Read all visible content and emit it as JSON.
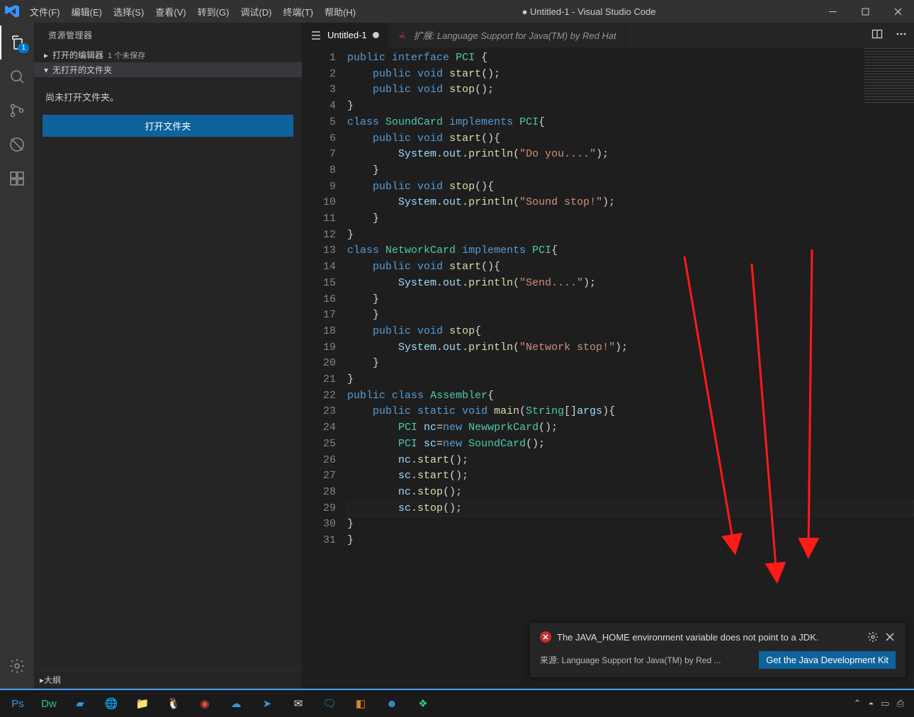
{
  "title": "● Untitled-1 - Visual Studio Code",
  "menu": [
    "文件(F)",
    "编辑(E)",
    "选择(S)",
    "查看(V)",
    "转到(G)",
    "调试(D)",
    "终端(T)",
    "帮助(H)"
  ],
  "activitybar": {
    "badge": "1"
  },
  "sidebar": {
    "title": "资源管理器",
    "open_editors": "打开的编辑器",
    "open_editors_tag": "1 个未保存",
    "no_folder": "无打开的文件夹",
    "hint": "尚未打开文件夹。",
    "open_button": "打开文件夹",
    "outline": "大纲"
  },
  "tabs": {
    "active": "Untitled-1",
    "extension": "扩展: Language Support for Java(TM) by Red Hat"
  },
  "code": {
    "lines": [
      [
        [
          "kw",
          "public"
        ],
        [
          "txt",
          " "
        ],
        [
          "kw",
          "interface"
        ],
        [
          "txt",
          " "
        ],
        [
          "typ",
          "PCI"
        ],
        [
          "txt",
          " {"
        ]
      ],
      [
        [
          "txt",
          "    "
        ],
        [
          "kw",
          "public"
        ],
        [
          "txt",
          " "
        ],
        [
          "kw",
          "void"
        ],
        [
          "txt",
          " "
        ],
        [
          "fn",
          "start"
        ],
        [
          "txt",
          "();"
        ]
      ],
      [
        [
          "txt",
          "    "
        ],
        [
          "kw",
          "public"
        ],
        [
          "txt",
          " "
        ],
        [
          "kw",
          "void"
        ],
        [
          "txt",
          " "
        ],
        [
          "fn",
          "stop"
        ],
        [
          "txt",
          "();"
        ]
      ],
      [
        [
          "txt",
          "}"
        ]
      ],
      [
        [
          "kw",
          "class"
        ],
        [
          "txt",
          " "
        ],
        [
          "typ",
          "SoundCard"
        ],
        [
          "txt",
          " "
        ],
        [
          "kw",
          "implements"
        ],
        [
          "txt",
          " "
        ],
        [
          "typ",
          "PCI"
        ],
        [
          "txt",
          "{"
        ]
      ],
      [
        [
          "txt",
          "    "
        ],
        [
          "kw",
          "public"
        ],
        [
          "txt",
          " "
        ],
        [
          "kw",
          "void"
        ],
        [
          "txt",
          " "
        ],
        [
          "fn",
          "start"
        ],
        [
          "txt",
          "(){"
        ]
      ],
      [
        [
          "txt",
          "        "
        ],
        [
          "id",
          "System"
        ],
        [
          "txt",
          "."
        ],
        [
          "id",
          "out"
        ],
        [
          "txt",
          "."
        ],
        [
          "fn",
          "println"
        ],
        [
          "txt",
          "("
        ],
        [
          "str",
          "\"Do you....\""
        ],
        [
          "txt",
          ");"
        ]
      ],
      [
        [
          "txt",
          "    }"
        ]
      ],
      [
        [
          "txt",
          "    "
        ],
        [
          "kw",
          "public"
        ],
        [
          "txt",
          " "
        ],
        [
          "kw",
          "void"
        ],
        [
          "txt",
          " "
        ],
        [
          "fn",
          "stop"
        ],
        [
          "txt",
          "(){"
        ]
      ],
      [
        [
          "txt",
          "        "
        ],
        [
          "id",
          "System"
        ],
        [
          "txt",
          "."
        ],
        [
          "id",
          "out"
        ],
        [
          "txt",
          "."
        ],
        [
          "fn",
          "println"
        ],
        [
          "txt",
          "("
        ],
        [
          "str",
          "\"Sound stop!\""
        ],
        [
          "txt",
          ");"
        ]
      ],
      [
        [
          "txt",
          "    }"
        ]
      ],
      [
        [
          "txt",
          "}"
        ]
      ],
      [
        [
          "kw",
          "class"
        ],
        [
          "txt",
          " "
        ],
        [
          "typ",
          "NetworkCard"
        ],
        [
          "txt",
          " "
        ],
        [
          "kw",
          "implements"
        ],
        [
          "txt",
          " "
        ],
        [
          "typ",
          "PCI"
        ],
        [
          "txt",
          "{"
        ]
      ],
      [
        [
          "txt",
          "    "
        ],
        [
          "kw",
          "public"
        ],
        [
          "txt",
          " "
        ],
        [
          "kw",
          "void"
        ],
        [
          "txt",
          " "
        ],
        [
          "fn",
          "start"
        ],
        [
          "txt",
          "(){"
        ]
      ],
      [
        [
          "txt",
          "        "
        ],
        [
          "id",
          "System"
        ],
        [
          "txt",
          "."
        ],
        [
          "id",
          "out"
        ],
        [
          "txt",
          "."
        ],
        [
          "fn",
          "println"
        ],
        [
          "txt",
          "("
        ],
        [
          "str",
          "\"Send....\""
        ],
        [
          "txt",
          ");"
        ]
      ],
      [
        [
          "txt",
          "    }"
        ]
      ],
      [
        [
          "txt",
          "    }"
        ]
      ],
      [
        [
          "txt",
          "    "
        ],
        [
          "kw",
          "public"
        ],
        [
          "txt",
          " "
        ],
        [
          "kw",
          "void"
        ],
        [
          "txt",
          " "
        ],
        [
          "fn",
          "stop"
        ],
        [
          "txt",
          "{"
        ]
      ],
      [
        [
          "txt",
          "        "
        ],
        [
          "id",
          "System"
        ],
        [
          "txt",
          "."
        ],
        [
          "id",
          "out"
        ],
        [
          "txt",
          "."
        ],
        [
          "fn",
          "println"
        ],
        [
          "txt",
          "("
        ],
        [
          "str",
          "\"Network stop!\""
        ],
        [
          "txt",
          ");"
        ]
      ],
      [
        [
          "txt",
          "    }"
        ]
      ],
      [
        [
          "txt",
          "}"
        ]
      ],
      [
        [
          "kw",
          "public"
        ],
        [
          "txt",
          " "
        ],
        [
          "kw",
          "class"
        ],
        [
          "txt",
          " "
        ],
        [
          "typ",
          "Assembler"
        ],
        [
          "txt",
          "{"
        ]
      ],
      [
        [
          "txt",
          "    "
        ],
        [
          "kw",
          "public"
        ],
        [
          "txt",
          " "
        ],
        [
          "kw",
          "static"
        ],
        [
          "txt",
          " "
        ],
        [
          "kw",
          "void"
        ],
        [
          "txt",
          " "
        ],
        [
          "fn",
          "main"
        ],
        [
          "txt",
          "("
        ],
        [
          "typ",
          "String"
        ],
        [
          "txt",
          "[]"
        ],
        [
          "id",
          "args"
        ],
        [
          "txt",
          "){"
        ]
      ],
      [
        [
          "txt",
          "        "
        ],
        [
          "typ",
          "PCI"
        ],
        [
          "txt",
          " "
        ],
        [
          "id",
          "nc"
        ],
        [
          "txt",
          "="
        ],
        [
          "kw",
          "new"
        ],
        [
          "txt",
          " "
        ],
        [
          "typ",
          "NewwprkCard"
        ],
        [
          "txt",
          "();"
        ]
      ],
      [
        [
          "txt",
          "        "
        ],
        [
          "typ",
          "PCI"
        ],
        [
          "txt",
          " "
        ],
        [
          "id",
          "sc"
        ],
        [
          "txt",
          "="
        ],
        [
          "kw",
          "new"
        ],
        [
          "txt",
          " "
        ],
        [
          "typ",
          "SoundCard"
        ],
        [
          "txt",
          "();"
        ]
      ],
      [
        [
          "txt",
          "        "
        ],
        [
          "id",
          "nc"
        ],
        [
          "txt",
          "."
        ],
        [
          "fn",
          "start"
        ],
        [
          "txt",
          "();"
        ]
      ],
      [
        [
          "txt",
          "        "
        ],
        [
          "id",
          "sc"
        ],
        [
          "txt",
          "."
        ],
        [
          "fn",
          "start"
        ],
        [
          "txt",
          "();"
        ]
      ],
      [
        [
          "txt",
          "        "
        ],
        [
          "id",
          "nc"
        ],
        [
          "txt",
          "."
        ],
        [
          "fn",
          "stop"
        ],
        [
          "txt",
          "();"
        ]
      ],
      [
        [
          "txt",
          "        "
        ],
        [
          "id",
          "sc"
        ],
        [
          "txt",
          "."
        ],
        [
          "fn",
          "stop"
        ],
        [
          "txt",
          "();"
        ]
      ],
      [
        [
          "txt",
          "}"
        ]
      ],
      [
        [
          "txt",
          "}"
        ]
      ]
    ]
  },
  "notification": {
    "message": "The JAVA_HOME environment variable does not point to a JDK.",
    "source": "来源: Language Support for Java(TM) by Red ...",
    "action": "Get the Java Development Kit"
  }
}
